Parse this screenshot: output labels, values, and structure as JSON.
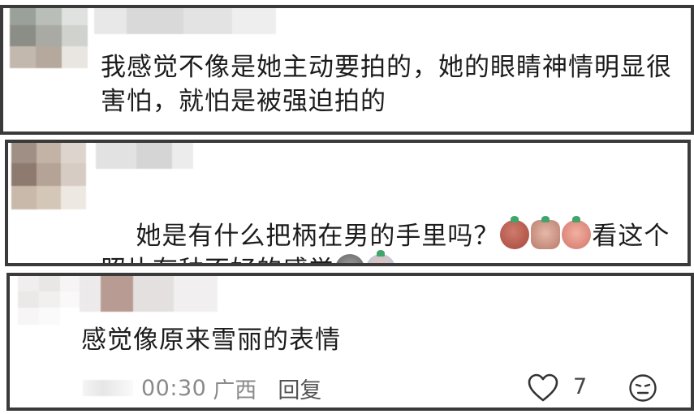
{
  "comments": [
    {
      "text": "我感觉不像是她主动要拍的，她的眼睛神情明显很害怕，就怕是被强迫拍的"
    },
    {
      "text_before": "她是有什么把柄在男的手里吗？",
      "emojis_inline_1": [
        "smirk-emoji",
        "peek-emoji",
        "cry-emoji"
      ],
      "text_after": "看这个照片有种不好的感觉",
      "emojis_inline_2": [
        "sad-emoji",
        "scared-emoji"
      ]
    },
    {
      "text": "感觉像原来雪丽的表情",
      "footer": {
        "time": "00:30",
        "region": "广西",
        "reply": "回复",
        "likes": "7"
      }
    }
  ],
  "colors": {
    "border": "#3a3a3a",
    "text": "#1c1c1c",
    "meta": "#8a8a8a"
  },
  "icons": {
    "like": "heart-icon",
    "emoji_reply": "smiley-icon"
  }
}
